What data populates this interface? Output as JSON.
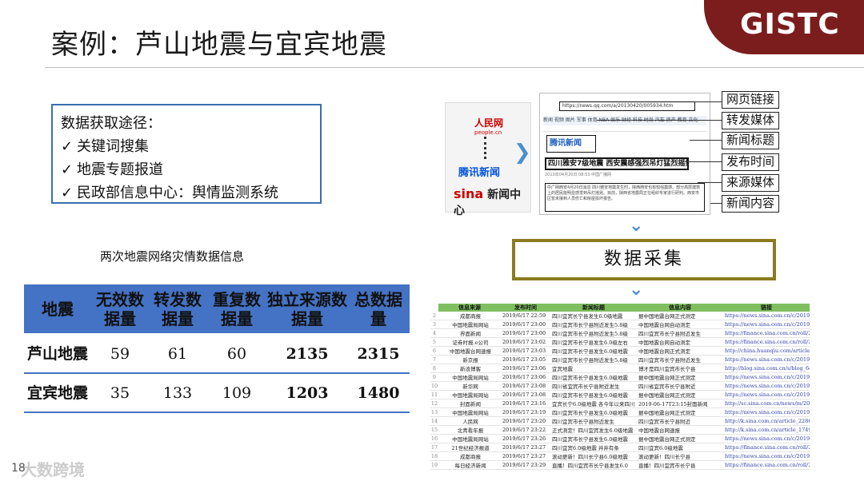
{
  "slide": {
    "title": "案例：芦山地震与宜宾地震",
    "logo": "GISTC",
    "page_number": "18",
    "footer_brand": "大数跨境"
  },
  "sources_box": {
    "heading": "数据获取途径：",
    "items": [
      "关键词搜集",
      "地震专题报道",
      "民政部信息中心：舆情监测系统"
    ]
  },
  "table": {
    "caption": "两次地震网络灾情数据信息",
    "headers": [
      "地震",
      "无效数据量",
      "转发数据量",
      "重复数据量",
      "独立来源数据量",
      "总数据量"
    ],
    "rows": [
      {
        "name": "芦山地震",
        "invalid": "59",
        "forward": "61",
        "duplicate": "60",
        "independent": "2135",
        "total": "2315"
      },
      {
        "name": "宜宾地震",
        "invalid": "35",
        "forward": "133",
        "duplicate": "109",
        "independent": "1203",
        "total": "1480"
      }
    ]
  },
  "diagram": {
    "media_logos": {
      "people": "人民网",
      "people_sub": "people.cn",
      "tencent": "腾讯新闻",
      "sina_mark": "sina",
      "sina_text": "新闻中心"
    },
    "webpage": {
      "url": "https://news.qq.com/a/20130420/005934.htm",
      "nav": "新闻 视频 图片 军事 体育 NBA 娱乐 财经 科技 时尚 汽车 房产 教育 文化",
      "source_badge": "腾讯新闻",
      "headline": "四川雅安7级地震 西安震感强烈吊灯猛烈摇晃",
      "meta": "2013年04月20日 08:53 中国广播网",
      "body": "中广网西安4月20日消息 四川雅安地震发生时，陕西西安也有较强震感。部分高层建筑上的居民能明显感觉到吊灯摇晃。目前，陕西省地震局正在组织专家进行研判。西安市区暂未接到人员伤亡和房屋损坏报告。"
    },
    "labels": [
      "网页链接",
      "转发媒体",
      "新闻标题",
      "发布时间",
      "来源媒体",
      "新闻内容"
    ],
    "process_label": "数据采集"
  },
  "spreadsheet": {
    "headers": [
      "信息来源",
      "发布时间",
      "新闻标题",
      "信息内容",
      "链接"
    ],
    "rows": [
      [
        "成都商报",
        "2019/6/17 22:59",
        "四川宜宾长宁县发生6.0级地震",
        "据中国地震台网正式测定",
        "https://news.sina.com.cn/c/2019-06"
      ],
      [
        "中国地震局网站",
        "2019/6/17 23:00",
        "四川宜宾市长宁县附近发生5.8级",
        "中国地震台网自动测定",
        "https://news.sina.com.cn/c/2019-06"
      ],
      [
        "界面新闻",
        "2019/6/17 23:00",
        "四川宜宾市长宁县附近发生5.8级",
        "四川宜宾市长宁县附近发生",
        "https://finance.sina.com.cn/roll/2"
      ],
      [
        "证券时报.e公司",
        "2019/6/17 23:02",
        "四川宜宾市长宁县发生6.0级左右",
        "中国地震台网自动测定",
        "https://finance.sina.com.cn/roll/2"
      ],
      [
        "中国地震台网速报",
        "2019/6/17 23:03",
        "四川宜宾市长宁县发生6.0级地震",
        "中国地震台网正式测定",
        "http://china.huanqiu.com/article/2"
      ],
      [
        "新京报",
        "2019/6/17 23:05",
        "四川宜宾市长宁县附近发生5.8级",
        "四川宜宾市长宁县附近发生",
        "https://news.sina.com.cn/c/2019-06"
      ],
      [
        "新浪博客",
        "2019/6/17 23:06",
        "宜宾地震",
        "博才是四川宜宾市长宁县",
        "http://blog.sina.com.cn/s/blog_6eb"
      ],
      [
        "中国地震局网站",
        "2019/6/17 23:06",
        "四川宜宾市长宁县发生6.0级地震",
        "据中国地震台网正式测定",
        "https://news.sina.com.cn/c/2019-06"
      ],
      [
        "新华网",
        "2019/6/17 23:08",
        "四川省宜宾市长宁县附近发生",
        "四川省宜宾市长宁县附近",
        "https://news.sina.com.cn/c/2019-06"
      ],
      [
        "中国地震局网站",
        "2019/6/17 23:08",
        "四川宜宾市长宁县发生6.0级地震",
        "据中国地震台网正式测定",
        "https://news.sina.com.cn/c/2019-06"
      ],
      [
        "封面新闻",
        "2019/6/17 23:16",
        "宜宾长宁6.0级地震 各今年以来四川",
        "2019-06-17T23:15封面新闻",
        "http://sc.sina.com.cn/news/m/2019"
      ],
      [
        "中国地震局网站",
        "2019/6/17 23:19",
        "四川宜宾市长宁县发生6.0级地震",
        "据中国地震台网正式测定",
        "https://news.sina.com.cn/c/2019-06"
      ],
      [
        "人民网",
        "2019/6/17 23:20",
        "四川宜宾市长宁县附近发生",
        "四川宜宾市长宁县附近",
        "http://k.sina.com.cn/article_22869"
      ],
      [
        "北青看年报",
        "2019/6/17 23:22",
        "正式测定！四川宜宾发生6.0级地震",
        "中国地震台网速报",
        "http://k.sina.com.cn/article_17499"
      ],
      [
        "中国地震局网站",
        "2019/6/17 23:26",
        "四川宜宾市长宁县发生6.0级地震",
        "据中国地震台网正式测定",
        "https://news.sina.com.cn/c/2019-06"
      ],
      [
        "21世纪经济报道",
        "2019/6/17 23:27",
        "四川宜宾6.0级地震 井井有条",
        "四川宜宾6.0级地震",
        "https://finance.sina.com.cn/roll/2"
      ],
      [
        "成都商报",
        "2019/6/17 23:27",
        "滚动更新！四川长宁县6.0级地震",
        "滚动更新！四川长宁县",
        "https://news.sina.com.cn/c/2019-06"
      ],
      [
        "每日经济新闻",
        "2019/6/17 23:29",
        "直播！四川宜宾市长宁县发生6.0",
        "直播！四川宜宾市长宁县",
        "https://finance.sina.com.cn/roll/2"
      ]
    ]
  }
}
